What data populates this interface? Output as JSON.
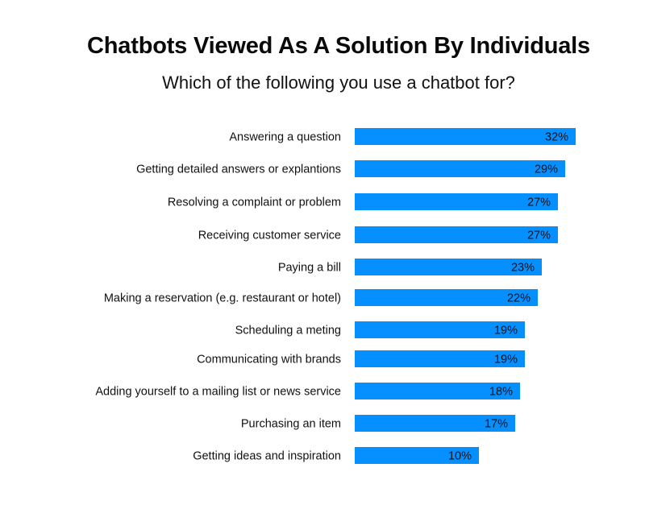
{
  "chart_data": {
    "type": "bar",
    "orientation": "horizontal",
    "title": "Chatbots Viewed As A Solution By Individuals",
    "subtitle": "Which of the following you use a chatbot for?",
    "xlabel": "",
    "ylabel": "",
    "grid": false,
    "legend": "none",
    "bar_color": "#0690ff",
    "value_suffix": "%",
    "xlim": [
      0,
      32
    ],
    "categories": [
      "Answering a question",
      "Getting detailed answers or explantions",
      "Resolving a complaint or problem",
      "Receiving customer service",
      "Paying a bill",
      "Making a reservation (e.g. restaurant or hotel)",
      "Scheduling a meting",
      "Communicating with brands",
      "Adding yourself to a mailing list or news service",
      "Purchasing an item",
      "Getting ideas and inspiration"
    ],
    "values": [
      32,
      29,
      27,
      27,
      23,
      22,
      19,
      19,
      18,
      17,
      10
    ],
    "data_labels": [
      "32%",
      "29%",
      "27%",
      "27%",
      "23%",
      "22%",
      "19%",
      "19%",
      "18%",
      "17%",
      "10%"
    ]
  }
}
